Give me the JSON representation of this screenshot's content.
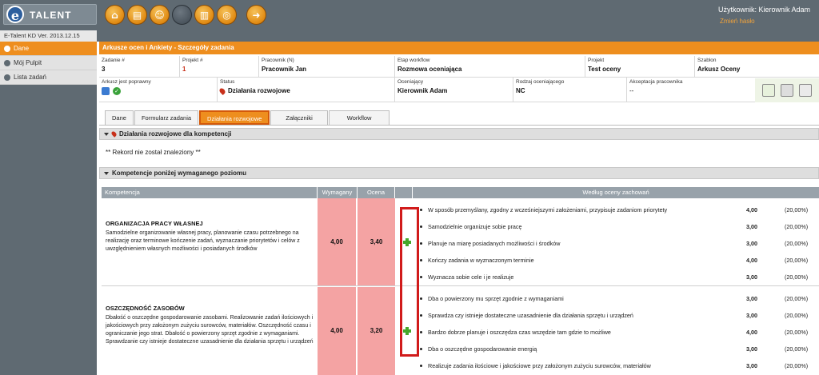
{
  "app": {
    "logo_letter": "e",
    "logo_text": "TALENT",
    "version": "E-Talent KD Ver. 2013.12.15",
    "user_label": "Użytkownik: Kierownik Adam",
    "change_password": "Zmień hasło",
    "nav_icons": [
      "home-icon",
      "calendar-icon",
      "people-icon",
      "blank-icon",
      "book-icon",
      "target-icon",
      "logout-icon"
    ]
  },
  "sidebar": {
    "items": [
      {
        "label": "Dane",
        "active": true
      },
      {
        "label": "Mój Pulpit",
        "active": false
      },
      {
        "label": "Lista zadań",
        "active": false
      }
    ]
  },
  "page_title": "Arkusze ocen i Ankiety - Szczegóły zadania",
  "info": {
    "zadanie_label": "Zadanie #",
    "zadanie_value": "3",
    "projekt_label": "Projekt #",
    "projekt_value": "1",
    "pracownik_label": "Pracownik (N)",
    "pracownik_value": "Pracownik Jan",
    "etap_label": "Etap workflow",
    "etap_value": "Rozmowa oceniająca",
    "projekt2_label": "Projekt",
    "projekt2_value": "Test oceny",
    "szablon_label": "Szablon",
    "szablon_value": "Arkusz Oceny",
    "arkusz_label": "Arkusz jest poprawny",
    "status_label": "Status",
    "status_value": "Działania rozwojowe",
    "oceniajacy_label": "Oceniający",
    "oceniajacy_value": "Kierownik Adam",
    "rodzaj_label": "Rodzaj oceniającego",
    "rodzaj_value": "NC",
    "akceptacja_label": "Akceptacja pracownika",
    "akceptacja_value": "--"
  },
  "tabs": [
    {
      "label": "Dane",
      "active": false
    },
    {
      "label": "Formularz zadania",
      "active": false
    },
    {
      "label": "Działania rozwojowe",
      "active": true
    },
    {
      "label": "Załączniki",
      "active": false
    },
    {
      "label": "Workflow",
      "active": false
    }
  ],
  "sections": {
    "dzialania_title": "Działania rozwojowe dla kompetencji",
    "no_record": "** Rekord nie został znaleziony **",
    "kompetencje_title": "Kompetencje poniżej wymaganego poziomu"
  },
  "table": {
    "headers": {
      "kompetencja": "Kompetencja",
      "wymagany": "Wymagany",
      "ocena": "Ocena",
      "wedlug": "Według oceny zachowań"
    },
    "rows": [
      {
        "title": "ORGANIZACJA PRACY WŁASNEJ",
        "description": "Samodzielne organizowanie własnej pracy,  planowanie czasu potrzebnego na realizację oraz terminowe kończenie zadań, wyznaczanie priorytetów i celów z uwzględnieniem własnych możliwości i posiadanych środków",
        "wymagany": "4,00",
        "ocena": "3,40",
        "behaviors": [
          {
            "text": "W sposób przemyślany, zgodny z wcześniejszymi założeniami, przypisuje zadaniom priorytety",
            "score": "4,00",
            "pct": "(20,00%)"
          },
          {
            "text": "Samodzielnie organizuje sobie pracę",
            "score": "3,00",
            "pct": "(20,00%)"
          },
          {
            "text": "Planuje na miarę posiadanych możliwości i środków",
            "score": "3,00",
            "pct": "(20,00%)"
          },
          {
            "text": "Kończy zadania w wyznaczonym terminie",
            "score": "4,00",
            "pct": "(20,00%)"
          },
          {
            "text": "Wyznacza sobie cele i je realizuje",
            "score": "3,00",
            "pct": "(20,00%)"
          }
        ]
      },
      {
        "title": "OSZCZĘDNOŚĆ ZASOBÓW",
        "description": "Dbałość o oszczędne gospodarowanie zasobami. Realizowanie zadań ilościowych i jakościowych przy założonym zużyciu surowców, materiałów. Oszczędność czasu i ograniczanie jego strat. Dbałość o powierzony sprzęt zgodnie z wymaganiami. Sprawdzanie czy istnieje dostateczne uzasadnienie dla działania sprzętu i urządzeń",
        "wymagany": "4,00",
        "ocena": "3,20",
        "behaviors": [
          {
            "text": "Dba o powierzony mu sprzęt zgodnie z wymaganiami",
            "score": "3,00",
            "pct": "(20,00%)"
          },
          {
            "text": "Sprawdza czy istnieje dostateczne uzasadnienie dla działania sprzętu i urządzeń",
            "score": "3,00",
            "pct": "(20,00%)"
          },
          {
            "text": "Bardzo dobrze planuje i oszczędza czas wszędzie tam gdzie to możliwe",
            "score": "4,00",
            "pct": "(20,00%)"
          },
          {
            "text": "Dba o oszczędne gospodarowanie energią",
            "score": "3,00",
            "pct": "(20,00%)"
          },
          {
            "text": "Realizuje zadania ilościowe i jakościowe przy założonym zużyciu surowców, materiałów",
            "score": "3,00",
            "pct": "(20,00%)"
          }
        ]
      }
    ]
  }
}
